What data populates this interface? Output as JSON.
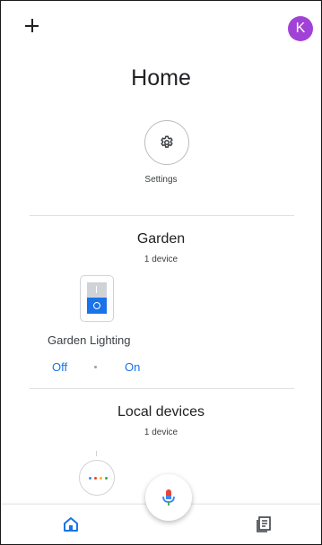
{
  "header": {
    "title": "Home",
    "avatar_initial": "K",
    "avatar_color": "#a142d6",
    "add_icon": "plus-icon"
  },
  "settings": {
    "label": "Settings",
    "icon": "gear-icon"
  },
  "rooms": [
    {
      "name": "Garden",
      "device_count": "1 device",
      "devices": [
        {
          "name": "Garden Lighting",
          "icon": "light-switch-icon",
          "off_label": "Off",
          "on_label": "On"
        }
      ]
    }
  ],
  "local_devices": {
    "name": "Local devices",
    "device_count": "1 device",
    "device_icon": "smart-speaker-icon"
  },
  "bottom_nav": {
    "home_icon": "home-icon",
    "feed_icon": "feed-icon",
    "mic_icon": "microphone-icon"
  },
  "colors": {
    "accent": "#1a73e8",
    "google_blue": "#4285f4",
    "google_red": "#ea4335",
    "google_yellow": "#fbbc05",
    "google_green": "#34a853"
  }
}
